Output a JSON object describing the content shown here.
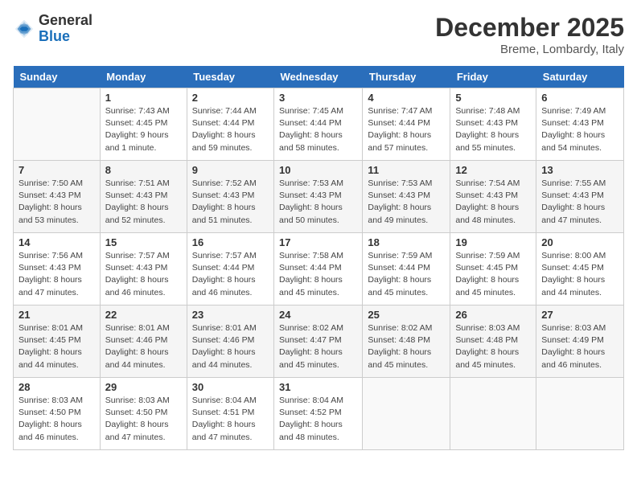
{
  "logo": {
    "general": "General",
    "blue": "Blue"
  },
  "header": {
    "month": "December 2025",
    "location": "Breme, Lombardy, Italy"
  },
  "days_of_week": [
    "Sunday",
    "Monday",
    "Tuesday",
    "Wednesday",
    "Thursday",
    "Friday",
    "Saturday"
  ],
  "weeks": [
    [
      {
        "day": "",
        "info": ""
      },
      {
        "day": "1",
        "info": "Sunrise: 7:43 AM\nSunset: 4:45 PM\nDaylight: 9 hours\nand 1 minute."
      },
      {
        "day": "2",
        "info": "Sunrise: 7:44 AM\nSunset: 4:44 PM\nDaylight: 8 hours\nand 59 minutes."
      },
      {
        "day": "3",
        "info": "Sunrise: 7:45 AM\nSunset: 4:44 PM\nDaylight: 8 hours\nand 58 minutes."
      },
      {
        "day": "4",
        "info": "Sunrise: 7:47 AM\nSunset: 4:44 PM\nDaylight: 8 hours\nand 57 minutes."
      },
      {
        "day": "5",
        "info": "Sunrise: 7:48 AM\nSunset: 4:43 PM\nDaylight: 8 hours\nand 55 minutes."
      },
      {
        "day": "6",
        "info": "Sunrise: 7:49 AM\nSunset: 4:43 PM\nDaylight: 8 hours\nand 54 minutes."
      }
    ],
    [
      {
        "day": "7",
        "info": "Sunrise: 7:50 AM\nSunset: 4:43 PM\nDaylight: 8 hours\nand 53 minutes."
      },
      {
        "day": "8",
        "info": "Sunrise: 7:51 AM\nSunset: 4:43 PM\nDaylight: 8 hours\nand 52 minutes."
      },
      {
        "day": "9",
        "info": "Sunrise: 7:52 AM\nSunset: 4:43 PM\nDaylight: 8 hours\nand 51 minutes."
      },
      {
        "day": "10",
        "info": "Sunrise: 7:53 AM\nSunset: 4:43 PM\nDaylight: 8 hours\nand 50 minutes."
      },
      {
        "day": "11",
        "info": "Sunrise: 7:53 AM\nSunset: 4:43 PM\nDaylight: 8 hours\nand 49 minutes."
      },
      {
        "day": "12",
        "info": "Sunrise: 7:54 AM\nSunset: 4:43 PM\nDaylight: 8 hours\nand 48 minutes."
      },
      {
        "day": "13",
        "info": "Sunrise: 7:55 AM\nSunset: 4:43 PM\nDaylight: 8 hours\nand 47 minutes."
      }
    ],
    [
      {
        "day": "14",
        "info": "Sunrise: 7:56 AM\nSunset: 4:43 PM\nDaylight: 8 hours\nand 47 minutes."
      },
      {
        "day": "15",
        "info": "Sunrise: 7:57 AM\nSunset: 4:43 PM\nDaylight: 8 hours\nand 46 minutes."
      },
      {
        "day": "16",
        "info": "Sunrise: 7:57 AM\nSunset: 4:44 PM\nDaylight: 8 hours\nand 46 minutes."
      },
      {
        "day": "17",
        "info": "Sunrise: 7:58 AM\nSunset: 4:44 PM\nDaylight: 8 hours\nand 45 minutes."
      },
      {
        "day": "18",
        "info": "Sunrise: 7:59 AM\nSunset: 4:44 PM\nDaylight: 8 hours\nand 45 minutes."
      },
      {
        "day": "19",
        "info": "Sunrise: 7:59 AM\nSunset: 4:45 PM\nDaylight: 8 hours\nand 45 minutes."
      },
      {
        "day": "20",
        "info": "Sunrise: 8:00 AM\nSunset: 4:45 PM\nDaylight: 8 hours\nand 44 minutes."
      }
    ],
    [
      {
        "day": "21",
        "info": "Sunrise: 8:01 AM\nSunset: 4:45 PM\nDaylight: 8 hours\nand 44 minutes."
      },
      {
        "day": "22",
        "info": "Sunrise: 8:01 AM\nSunset: 4:46 PM\nDaylight: 8 hours\nand 44 minutes."
      },
      {
        "day": "23",
        "info": "Sunrise: 8:01 AM\nSunset: 4:46 PM\nDaylight: 8 hours\nand 44 minutes."
      },
      {
        "day": "24",
        "info": "Sunrise: 8:02 AM\nSunset: 4:47 PM\nDaylight: 8 hours\nand 45 minutes."
      },
      {
        "day": "25",
        "info": "Sunrise: 8:02 AM\nSunset: 4:48 PM\nDaylight: 8 hours\nand 45 minutes."
      },
      {
        "day": "26",
        "info": "Sunrise: 8:03 AM\nSunset: 4:48 PM\nDaylight: 8 hours\nand 45 minutes."
      },
      {
        "day": "27",
        "info": "Sunrise: 8:03 AM\nSunset: 4:49 PM\nDaylight: 8 hours\nand 46 minutes."
      }
    ],
    [
      {
        "day": "28",
        "info": "Sunrise: 8:03 AM\nSunset: 4:50 PM\nDaylight: 8 hours\nand 46 minutes."
      },
      {
        "day": "29",
        "info": "Sunrise: 8:03 AM\nSunset: 4:50 PM\nDaylight: 8 hours\nand 47 minutes."
      },
      {
        "day": "30",
        "info": "Sunrise: 8:04 AM\nSunset: 4:51 PM\nDaylight: 8 hours\nand 47 minutes."
      },
      {
        "day": "31",
        "info": "Sunrise: 8:04 AM\nSunset: 4:52 PM\nDaylight: 8 hours\nand 48 minutes."
      },
      {
        "day": "",
        "info": ""
      },
      {
        "day": "",
        "info": ""
      },
      {
        "day": "",
        "info": ""
      }
    ]
  ]
}
